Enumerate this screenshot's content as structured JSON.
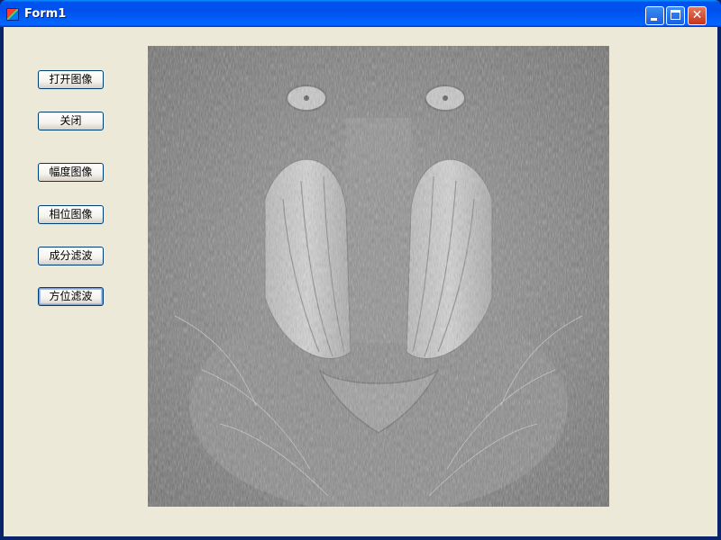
{
  "window": {
    "title": "Form1"
  },
  "buttons": {
    "open": "打开图像",
    "close": "关闭",
    "amplitude": "幅度图像",
    "phase": "相位图像",
    "component_filter": "成分滤波",
    "orientation_filter": "方位滤波"
  },
  "colors": {
    "titlebar": "#0054E3",
    "client_bg": "#ECE9D8",
    "button_border": "#003C74"
  },
  "image": {
    "content": "baboon face, grayscale emboss filter"
  }
}
